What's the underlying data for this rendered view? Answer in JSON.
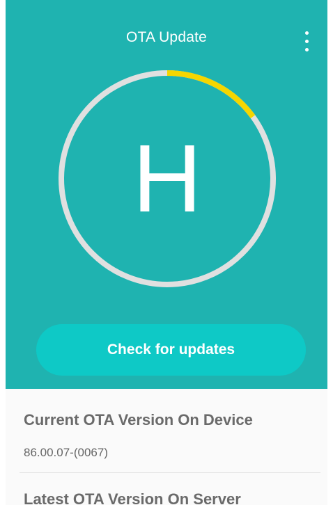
{
  "app": {
    "title": "OTA Update",
    "menu_icon": "more-vert-icon"
  },
  "colors": {
    "hero_bg": "#1fb3b0",
    "button_bg": "#0ec9c6",
    "ring_track": "#e0e0e0",
    "ring_progress": "#f5d600"
  },
  "dial": {
    "letter": "H",
    "progress": 0.15
  },
  "actions": {
    "check_label": "Check for updates"
  },
  "info": {
    "current_label": "Current OTA Version On Device",
    "current_value": "86.00.07-(0067)",
    "latest_label": "Latest OTA Version On Server"
  }
}
